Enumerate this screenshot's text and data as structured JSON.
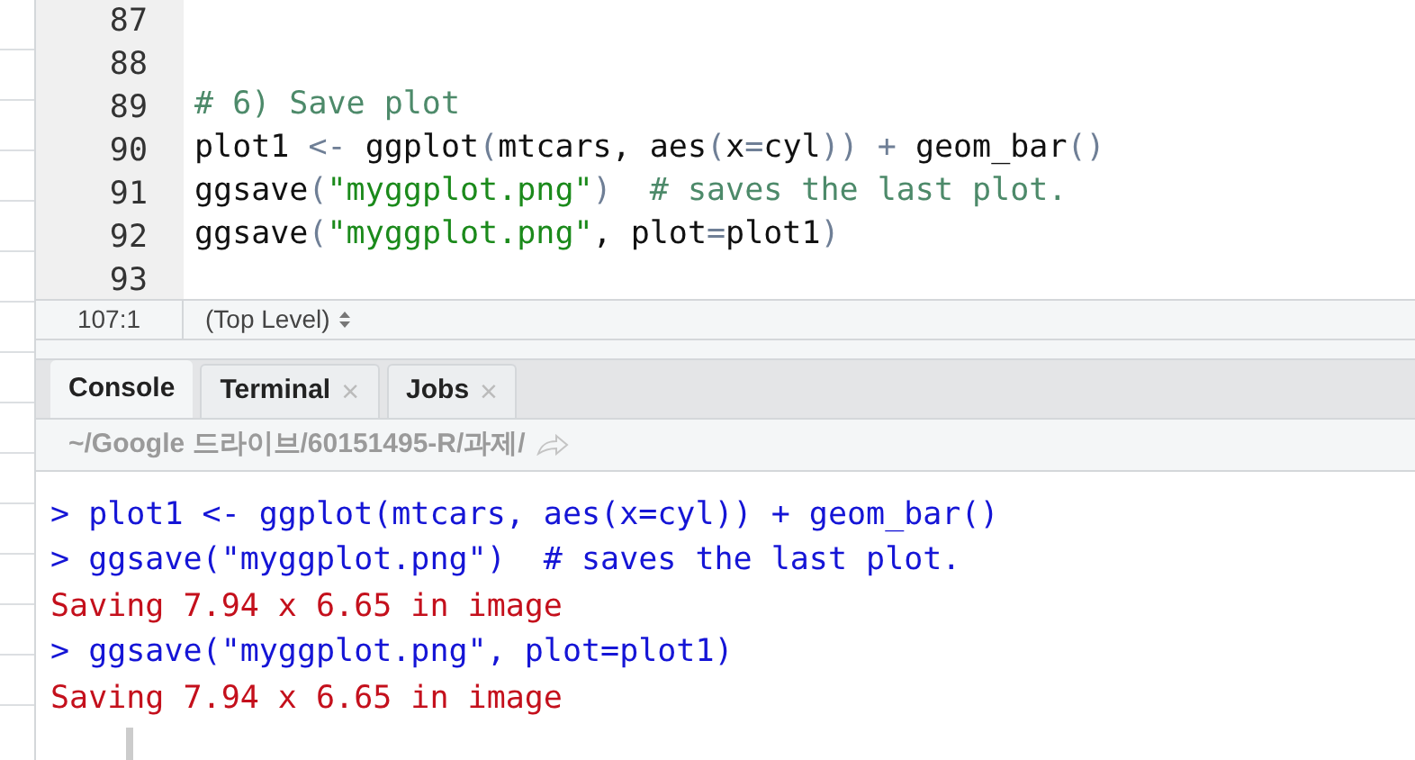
{
  "editor": {
    "lines": [
      {
        "number": "87"
      },
      {
        "number": "88"
      },
      {
        "number": "89",
        "tokens": [
          {
            "kind": "comment",
            "text": "# 6) Save plot"
          }
        ]
      },
      {
        "number": "90",
        "tokens": [
          {
            "kind": "plain",
            "text": "plot1 "
          },
          {
            "kind": "op",
            "text": "<-"
          },
          {
            "kind": "plain",
            "text": " ggplot"
          },
          {
            "kind": "op",
            "text": "("
          },
          {
            "kind": "plain",
            "text": "mtcars, aes"
          },
          {
            "kind": "op",
            "text": "("
          },
          {
            "kind": "plain",
            "text": "x"
          },
          {
            "kind": "op",
            "text": "="
          },
          {
            "kind": "plain",
            "text": "cyl"
          },
          {
            "kind": "op",
            "text": ")) + "
          },
          {
            "kind": "plain",
            "text": "geom_bar"
          },
          {
            "kind": "op",
            "text": "()"
          }
        ]
      },
      {
        "number": "91",
        "tokens": [
          {
            "kind": "plain",
            "text": "ggsave"
          },
          {
            "kind": "op",
            "text": "("
          },
          {
            "kind": "string",
            "text": "\"myggplot.png\""
          },
          {
            "kind": "op",
            "text": ")"
          },
          {
            "kind": "comment",
            "text": "  # saves the last plot."
          }
        ]
      },
      {
        "number": "92",
        "tokens": [
          {
            "kind": "plain",
            "text": "ggsave"
          },
          {
            "kind": "op",
            "text": "("
          },
          {
            "kind": "string",
            "text": "\"myggplot.png\""
          },
          {
            "kind": "plain",
            "text": ", plot"
          },
          {
            "kind": "op",
            "text": "="
          },
          {
            "kind": "plain",
            "text": "plot1"
          },
          {
            "kind": "op",
            "text": ")"
          }
        ]
      },
      {
        "number": "93"
      }
    ]
  },
  "status_bar": {
    "position": "107:1",
    "scope": "(Top Level)"
  },
  "console_tabs": [
    {
      "label": "Console",
      "selected": true
    },
    {
      "label": "Terminal",
      "selected": false,
      "close": "×"
    },
    {
      "label": "Jobs",
      "selected": false,
      "close": "×"
    }
  ],
  "path": "~/Google 드라이브/60151495-R/과제/",
  "console": [
    {
      "kind": "input",
      "text": "> plot1 <- ggplot(mtcars, aes(x=cyl)) + geom_bar()"
    },
    {
      "kind": "input",
      "text": "> ggsave(\"myggplot.png\")  # saves the last plot."
    },
    {
      "kind": "output",
      "text": "Saving 7.94 x 6.65 in image"
    },
    {
      "kind": "input",
      "text": "> ggsave(\"myggplot.png\", plot=plot1)"
    },
    {
      "kind": "output",
      "text": "Saving 7.94 x 6.65 in image"
    }
  ]
}
